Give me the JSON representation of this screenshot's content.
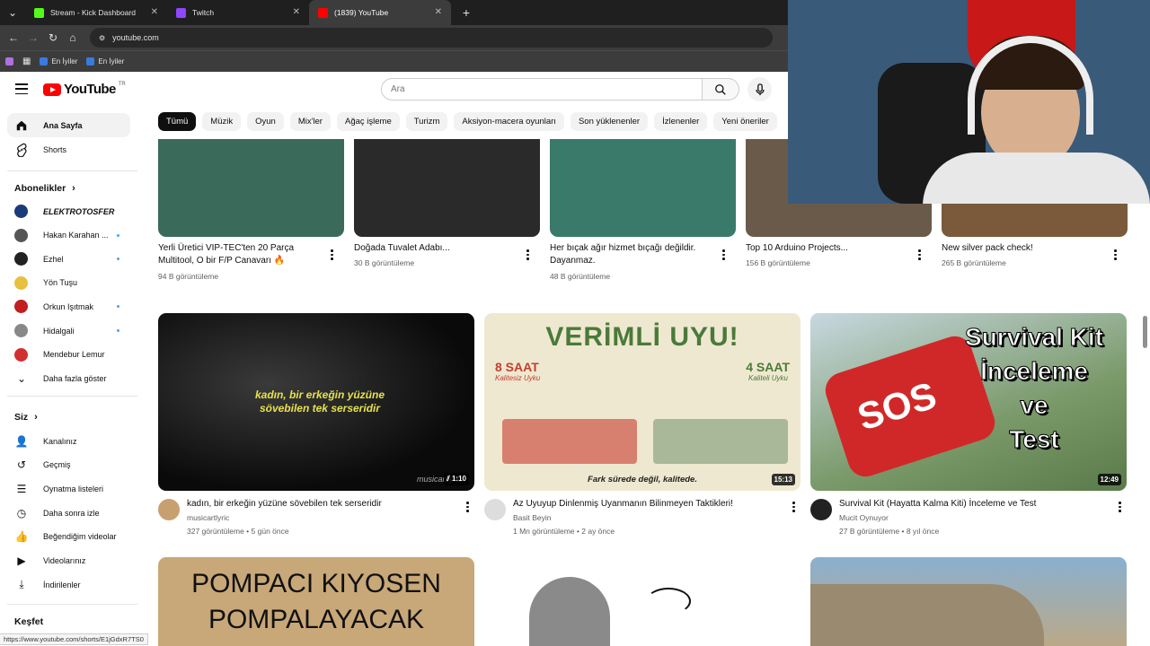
{
  "browser": {
    "tabs": [
      {
        "title": "Stream - Kick Dashboard",
        "color": "#53fc18",
        "active": false
      },
      {
        "title": "Twitch",
        "color": "#9146ff",
        "active": false
      },
      {
        "title": "(1839) YouTube",
        "color": "#ff0000",
        "active": true
      }
    ],
    "url": "youtube.com",
    "bookmarks": [
      "En İyiler",
      "En İyiler"
    ],
    "status_url": "https://www.youtube.com/shorts/E1jGdxR7TS0"
  },
  "header": {
    "logo": "YouTube",
    "region": "TR",
    "search_placeholder": "Ara"
  },
  "chips": [
    "Tümü",
    "Müzik",
    "Oyun",
    "Mix'ler",
    "Ağaç işleme",
    "Turizm",
    "Aksiyon-macera oyunları",
    "Son yüklenenler",
    "İzlenenler",
    "Yeni öneriler"
  ],
  "sidebar": {
    "main": [
      {
        "label": "Ana Sayfa",
        "icon": "home-icon"
      },
      {
        "label": "Shorts",
        "icon": "shorts-icon"
      }
    ],
    "subs_heading": "Abonelikler",
    "subs": [
      {
        "label": "ELEKTROTOSFER",
        "color": "#1a3a7a",
        "dot": false
      },
      {
        "label": "Hakan Karahan ...",
        "color": "#555555",
        "dot": true
      },
      {
        "label": "Ezhel",
        "color": "#222222",
        "dot": true
      },
      {
        "label": "Yön Tuşu",
        "color": "#e8c040",
        "dot": false
      },
      {
        "label": "Orkun Işıtmak",
        "color": "#c02020",
        "dot": true
      },
      {
        "label": "Hidalgali",
        "color": "#888888",
        "dot": true
      },
      {
        "label": "Mendebur Lemur",
        "color": "#d03030",
        "dot": false
      }
    ],
    "more": "Daha fazla göster",
    "you_heading": "Siz",
    "you": [
      {
        "label": "Kanalınız",
        "icon": "channel-icon"
      },
      {
        "label": "Geçmiş",
        "icon": "history-icon"
      },
      {
        "label": "Oynatma listeleri",
        "icon": "playlist-icon"
      },
      {
        "label": "Daha sonra izle",
        "icon": "clock-icon"
      },
      {
        "label": "Beğendiğim videolar",
        "icon": "like-icon"
      },
      {
        "label": "Videolarınız",
        "icon": "video-icon"
      },
      {
        "label": "İndirilenler",
        "icon": "download-icon"
      }
    ],
    "explore_heading": "Keşfet"
  },
  "shorts_row": [
    {
      "title1": "Yerli Üretici VIP-TEC'ten 20 Parça",
      "title2": "Multitool, O bir F/P Canavarı 🔥",
      "meta": "94 B görüntüleme",
      "thumb": "#3a6a5a"
    },
    {
      "title1": "Doğada Tuvalet Adabı...",
      "title2": "",
      "meta": "30 B görüntüleme",
      "thumb": "#2a2a2a"
    },
    {
      "title1": "Her bıçak ağır hizmet bıçağı değildir.",
      "title2": "Dayanmaz.",
      "meta": "48 B görüntüleme",
      "thumb": "#3a7a6a"
    },
    {
      "title1": "Top 10 Arduino Projects...",
      "title2": "",
      "meta": "156 B görüntüleme",
      "thumb": "#6a5a4a"
    },
    {
      "title1": "New silver pack check!",
      "title2": "",
      "meta": "265 B görüntüleme",
      "thumb": "#7a5a3a"
    }
  ],
  "videos": [
    {
      "title": "kadın, bir erkeğin yüzüne sövebilen tek serseridir",
      "channel": "musicartlyric",
      "views": "327 görüntüleme",
      "age": "5 gün önce",
      "duration": "1:10",
      "thumb_text": "kadın, bir erkeğin yüzüne sövebilen tek serseridir",
      "watermark": "musicartlyric"
    },
    {
      "title": "Az Uyuyup Dinlenmiş Uyanmanın Bilinmeyen Taktikleri!",
      "channel": "Basit Beyin",
      "views": "1 Mn görüntüleme",
      "age": "2 ay önce",
      "duration": "15:13",
      "thumb_title": "VERİMLİ UYU!",
      "left_label": "8 SAAT",
      "left_sub": "Kalitesiz Uyku",
      "right_label": "4 SAAT",
      "right_sub": "Kaliteli Uyku",
      "caption": "Fark sürede değil, kalitede."
    },
    {
      "title": "Survival Kit (Hayatta Kalma Kiti) İnceleme ve Test",
      "channel": "Mucit Oynuyor",
      "views": "27 B görüntüleme",
      "age": "8 yıl önce",
      "duration": "12:49",
      "thumb_lines": [
        "Survival Kit",
        "İnceleme",
        "ve",
        "Test"
      ],
      "badge": "SOS"
    }
  ],
  "bottom_row": [
    {
      "thumb_lines": [
        "POMPACI KIYOSEN",
        "POMPALAYACAK"
      ]
    },
    {
      "thumb_lines": []
    },
    {
      "thumb_lines": []
    }
  ],
  "separator": "•"
}
